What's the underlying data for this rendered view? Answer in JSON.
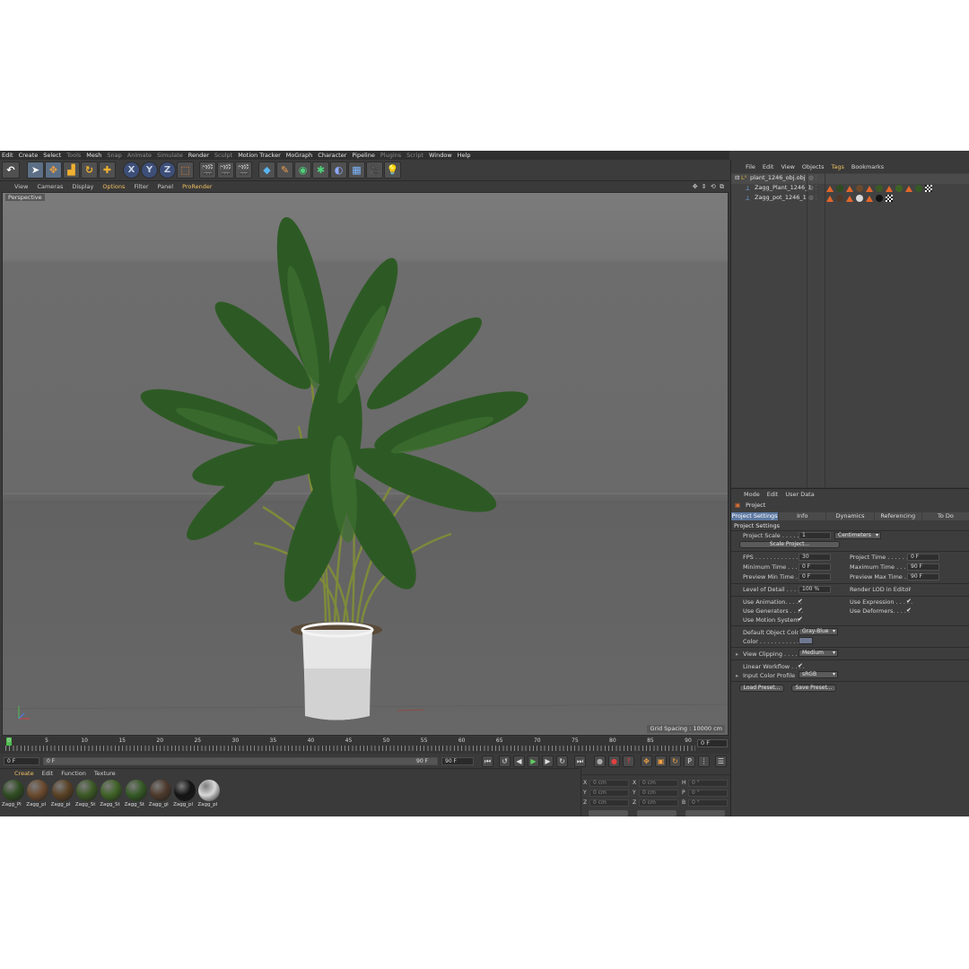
{
  "menubar": [
    "Edit",
    "Create",
    "Select",
    "Tools",
    "Mesh",
    "Snap",
    "Animate",
    "Simulate",
    "Render",
    "Sculpt",
    "Motion Tracker",
    "MoGraph",
    "Character",
    "Pipeline",
    "Plugins",
    "Script",
    "Window",
    "Help"
  ],
  "toolbar": {
    "axis_x": "X",
    "axis_y": "Y",
    "axis_z": "Z"
  },
  "viewport": {
    "menu": [
      "View",
      "Cameras",
      "Display",
      "Options",
      "Filter",
      "Panel",
      "ProRender"
    ],
    "label": "Perspective",
    "grid_spacing": "Grid Spacing : 10000 cm"
  },
  "timeline": {
    "ticks": [
      "0",
      "5",
      "10",
      "15",
      "20",
      "25",
      "30",
      "35",
      "40",
      "45",
      "50",
      "55",
      "60",
      "65",
      "70",
      "75",
      "80",
      "85",
      "90"
    ],
    "current_frame": "0 F",
    "start": "0 F",
    "range_start": "0 F",
    "range_end": "90 F",
    "end": "90 F"
  },
  "material_manager": {
    "menu": [
      "Create",
      "Edit",
      "Function",
      "Texture"
    ],
    "materials": [
      {
        "name": "Zagg_Pl",
        "color": "#2f4d22"
      },
      {
        "name": "Zagg_pl",
        "color": "#6b4a2e"
      },
      {
        "name": "Zagg_pl",
        "color": "#5a4124"
      },
      {
        "name": "Zagg_St",
        "color": "#3c5a25"
      },
      {
        "name": "Zagg_St",
        "color": "#3f6326"
      },
      {
        "name": "Zagg_St",
        "color": "#355a25"
      },
      {
        "name": "Zagg_gl",
        "color": "#4e3a2c"
      },
      {
        "name": "Zagg_pl",
        "color": "#141414"
      },
      {
        "name": "Zagg_pl",
        "color": "#d8d8d8"
      }
    ]
  },
  "coordinates": {
    "rows": [
      {
        "a": "X",
        "av": "0 cm",
        "b": "X",
        "bv": "0 cm",
        "c": "H",
        "cv": "0 °"
      },
      {
        "a": "Y",
        "av": "0 cm",
        "b": "Y",
        "bv": "0 cm",
        "c": "P",
        "cv": "0 °"
      },
      {
        "a": "Z",
        "av": "0 cm",
        "b": "Z",
        "bv": "0 cm",
        "c": "B",
        "cv": "0 °"
      }
    ]
  },
  "object_manager": {
    "menu": [
      "File",
      "Edit",
      "View",
      "Objects",
      "Tags",
      "Bookmarks"
    ],
    "objects": [
      {
        "name": "plant_1246_obj.obj"
      },
      {
        "name": "Zagg_Plant_1246_1"
      },
      {
        "name": "Zagg_pot_1246_1"
      }
    ]
  },
  "attributes": {
    "menu": [
      "Mode",
      "Edit",
      "User Data"
    ],
    "title": "Project",
    "tabs": [
      "Project Settings",
      "Info",
      "Dynamics",
      "Referencing",
      "To Do"
    ],
    "section": "Project Settings",
    "project_scale_label": "Project Scale . . . . . .",
    "project_scale_value": "1",
    "project_scale_unit": "Centimeters",
    "scale_project_btn": "Scale Project...",
    "fps_label": "FPS . . . . . . . . . . . . . .",
    "fps": "30",
    "project_time_label": "Project Time . . . . . . . .",
    "project_time": "0 F",
    "min_time_label": "Minimum Time . . . . .",
    "min_time": "0 F",
    "max_time_label": "Maximum Time . . . . .",
    "max_time": "90 F",
    "prev_min_label": "Preview Min Time . . .",
    "prev_min": "0 F",
    "prev_max_label": "Preview Max Time . . .",
    "prev_max": "90 F",
    "lod_label": "Level of Detail . . . . .",
    "lod": "100 %",
    "render_lod_label": "Render LOD in Editor",
    "use_animation": "Use Animation. . . . .",
    "use_expression": "Use Expression . . . . .",
    "use_generators": "Use Generators . . . .",
    "use_deformers": "Use Deformers. . . . .",
    "use_motion": "Use Motion System",
    "default_color_label": "Default Object Color",
    "default_color": "Gray-Blue",
    "color_label": "Color . . . . . . . . . . . . . .",
    "view_clipping_label": "View Clipping . . . . . . .",
    "view_clipping": "Medium",
    "linear_workflow": "Linear Workflow . . . .",
    "input_color_label": "Input Color Profile",
    "input_color": "sRGB",
    "load_preset": "Load Preset...",
    "save_preset": "Save Preset..."
  }
}
